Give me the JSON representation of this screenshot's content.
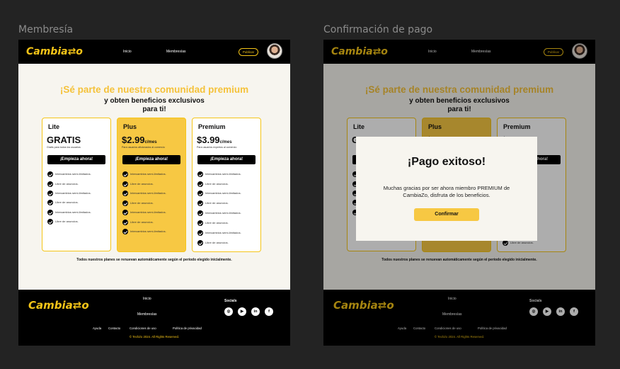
{
  "frames": [
    {
      "label": "Membresía"
    },
    {
      "label": "Confirmación de pago"
    }
  ],
  "nav": {
    "logo": "Cambia⇄o",
    "links": [
      "Inicio",
      "Membresías"
    ],
    "publish": "Publicar"
  },
  "hero": {
    "title": "¡Sé parte de nuestra comunidad premium",
    "subtitle_1": "y obten beneficios exclusivos",
    "subtitle_2": "para ti!"
  },
  "plans": [
    {
      "name": "Lite",
      "price": "GRATIS",
      "unit": "",
      "desc": "Gratis para todos los usuarios",
      "cta": "¡Empieza ahora!",
      "features": [
        "Intercambios semi-limitados.",
        "Libre de anuncios.",
        "Intercambios semi-limitados.",
        "Libre de anuncios.",
        "Intercambios semi-limitados.",
        "Libre de anuncios."
      ]
    },
    {
      "name": "Plus",
      "price": "$2.99",
      "unit": "c/mes",
      "desc": "Para usuarios aficionados al comercio",
      "cta": "¡Empieza ahora!",
      "features": [
        "Intercambios semi-limitados.",
        "Libre de anuncios.",
        "Intercambios semi-limitados.",
        "Libre de anuncios.",
        "Intercambios semi-limitados.",
        "Libre de anuncios.",
        "Intercambios semi-limitados."
      ]
    },
    {
      "name": "Premium",
      "price": "$3.99",
      "unit": "c/mes",
      "desc": "Para usuarios expertos al comercio",
      "cta": "¡Empieza ahora!",
      "features": [
        "Intercambios semi-limitados.",
        "Libre de anuncios.",
        "Intercambios semi-limitados.",
        "Libre de anuncios.",
        "Intercambios semi-limitados.",
        "Libre de anuncios.",
        "Intercambios semi-limitados.",
        "Libre de anuncios."
      ]
    }
  ],
  "renew_note": "Todos nuestros planes se renuevan automáticamente según el periodo elegido inicialmente.",
  "footer": {
    "logo": "Cambia⇄o",
    "inicio": "Inicio",
    "membresias": "Membresías",
    "socials": "Socials",
    "legal": [
      "Ayuda",
      "Contacto",
      "Condiciones de uso",
      "Política de privacidad"
    ],
    "copyright": "© TechZo 2024. All Rights Reserved.",
    "social_icons": [
      "instagram-icon",
      "youtube-icon",
      "linkedin-icon",
      "facebook-icon"
    ]
  },
  "modal": {
    "title": "¡Pago exitoso!",
    "text": "Muchas gracias por ser ahora miembro PREMIUM de CambiaZo, disfruta de los beneficios.",
    "button": "Confirmar"
  },
  "colors": {
    "accent": "#f5c518",
    "plus_card": "#f7c843",
    "nav_bg": "#000000",
    "canvas_bg": "#232323"
  }
}
